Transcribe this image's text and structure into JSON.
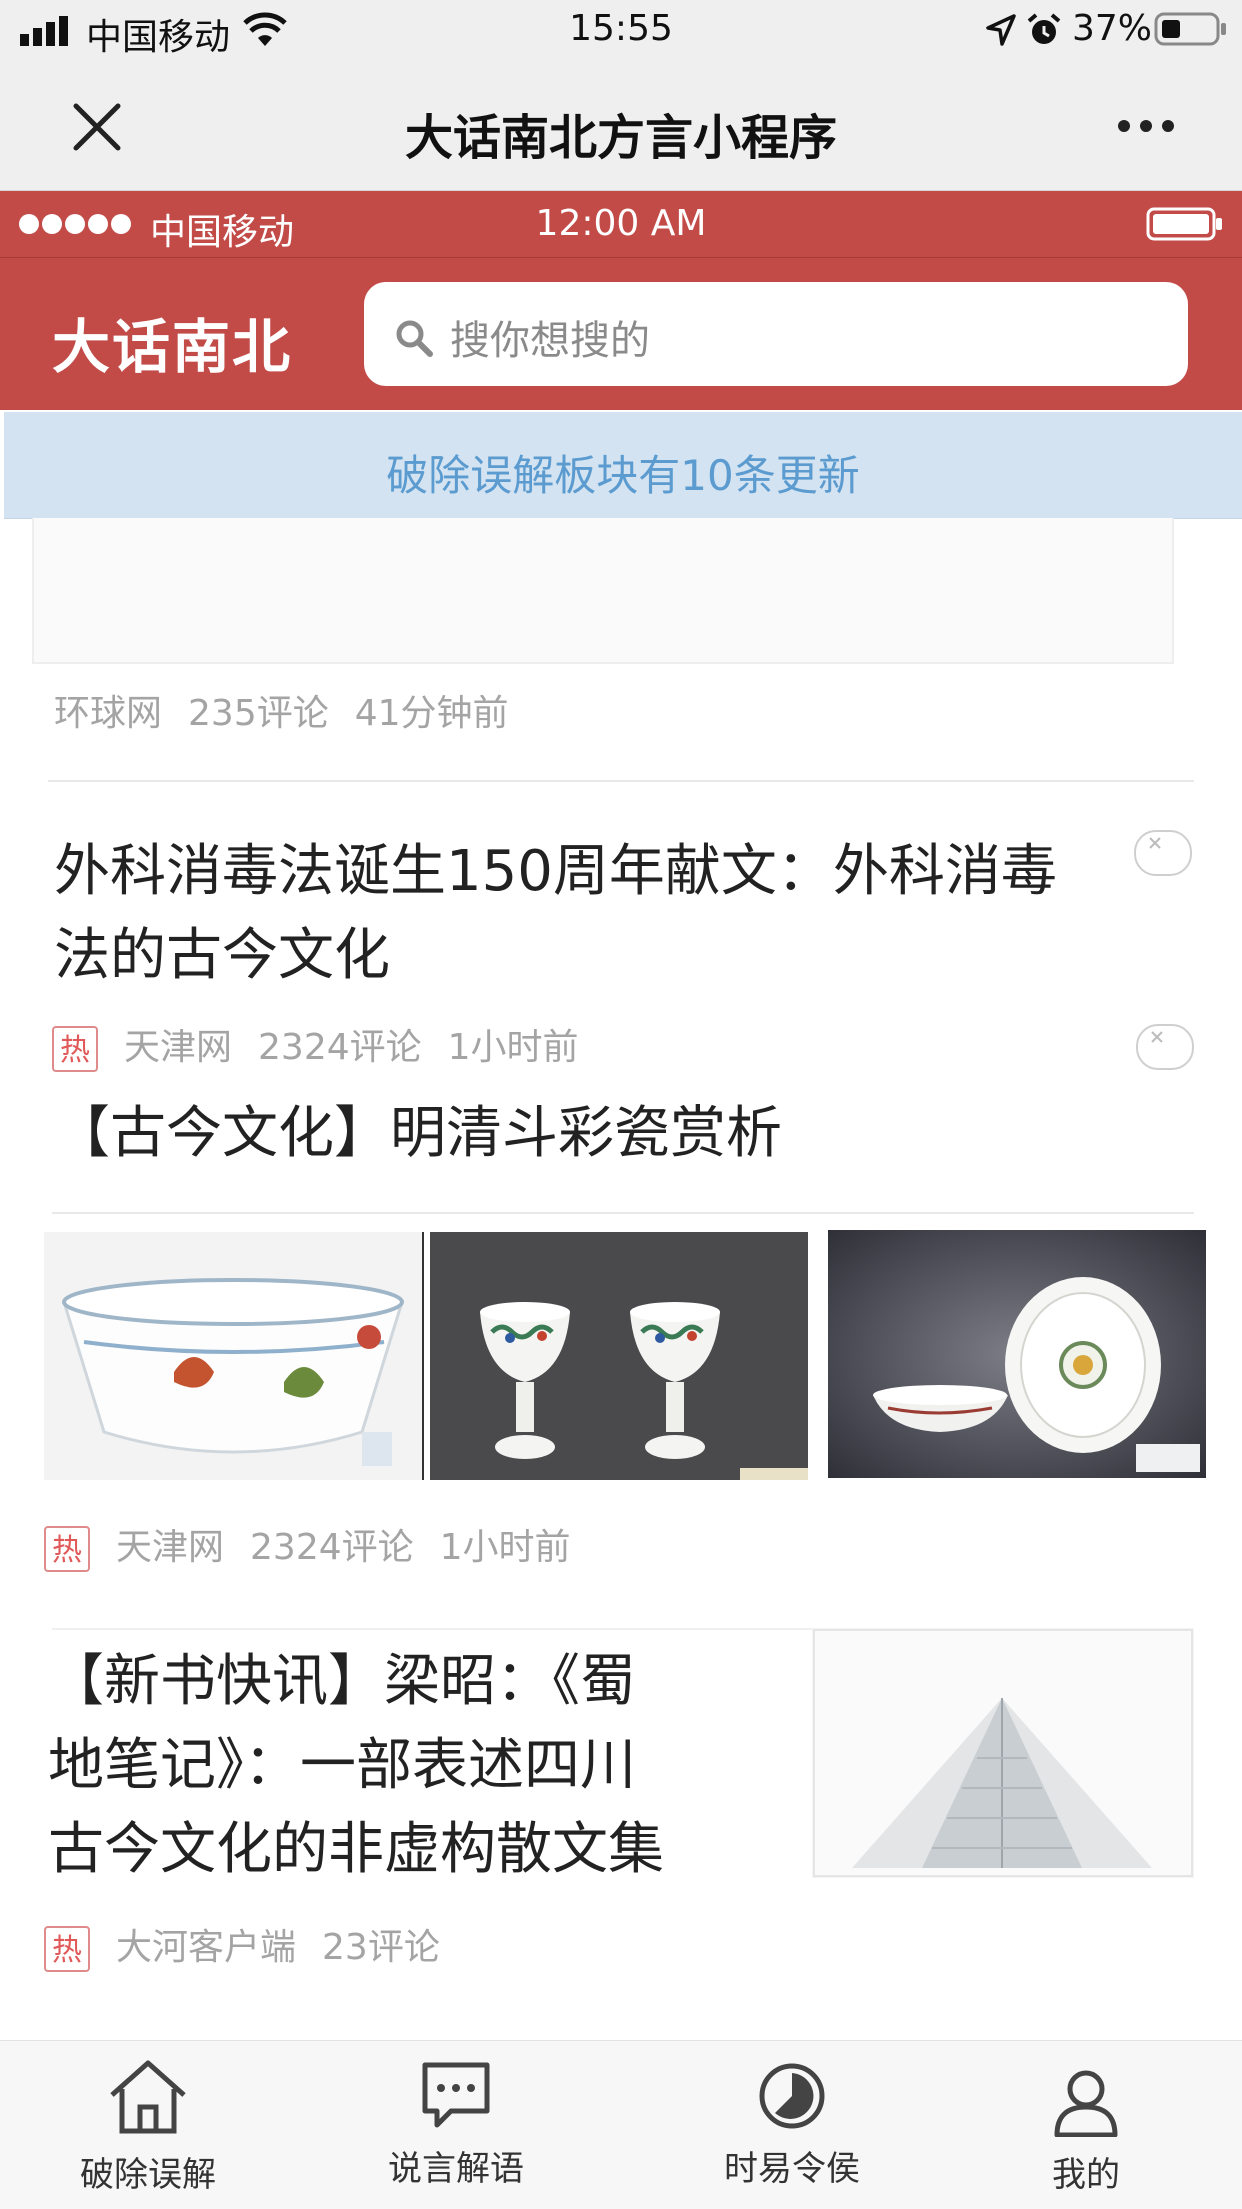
{
  "status_bar": {
    "carrier": "中国移动",
    "time": "15:55",
    "battery": "37%"
  },
  "nav": {
    "title": "大话南北方言小程序"
  },
  "inner_status": {
    "carrier": "中国移动",
    "time": "12:00 AM"
  },
  "app_header": {
    "brand": "大话南北",
    "search_placeholder": "搜你想搜的"
  },
  "banner": {
    "text": "破除误解板块有10条更新"
  },
  "feed": {
    "item0": {
      "source": "环球网",
      "comments": "235评论",
      "time": "41分钟前"
    },
    "item1": {
      "title_line1": "外科消毒法诞生150周年献文：外科消毒",
      "title_line2": "法的古今文化",
      "hot": "热",
      "source": "天津网",
      "comments": "2324评论",
      "time": "1小时前"
    },
    "item2": {
      "title": "【古今文化】明清斗彩瓷赏析",
      "hot": "热",
      "source": "天津网",
      "comments": "2324评论",
      "time": "1小时前"
    },
    "item3": {
      "title_line1": "【新书快讯】梁昭：《蜀",
      "title_line2": "地笔记》：一部表述四川",
      "title_line3": "古今文化的非虚构散文集",
      "hot": "热",
      "source": "大河客户端",
      "comments": "23评论"
    }
  },
  "tabbar": {
    "tabs": [
      {
        "label": "破除误解",
        "icon": "home-icon"
      },
      {
        "label": "说言解语",
        "icon": "chat-icon"
      },
      {
        "label": "时易令侯",
        "icon": "clock-icon"
      },
      {
        "label": "我的",
        "icon": "user-icon"
      }
    ]
  },
  "colors": {
    "brand_red": "#c24b48",
    "banner_bg": "#d3e3f1",
    "banner_text": "#5b9bcf",
    "meta_gray": "#a4a4a4",
    "hot_red": "#e05a5a"
  }
}
